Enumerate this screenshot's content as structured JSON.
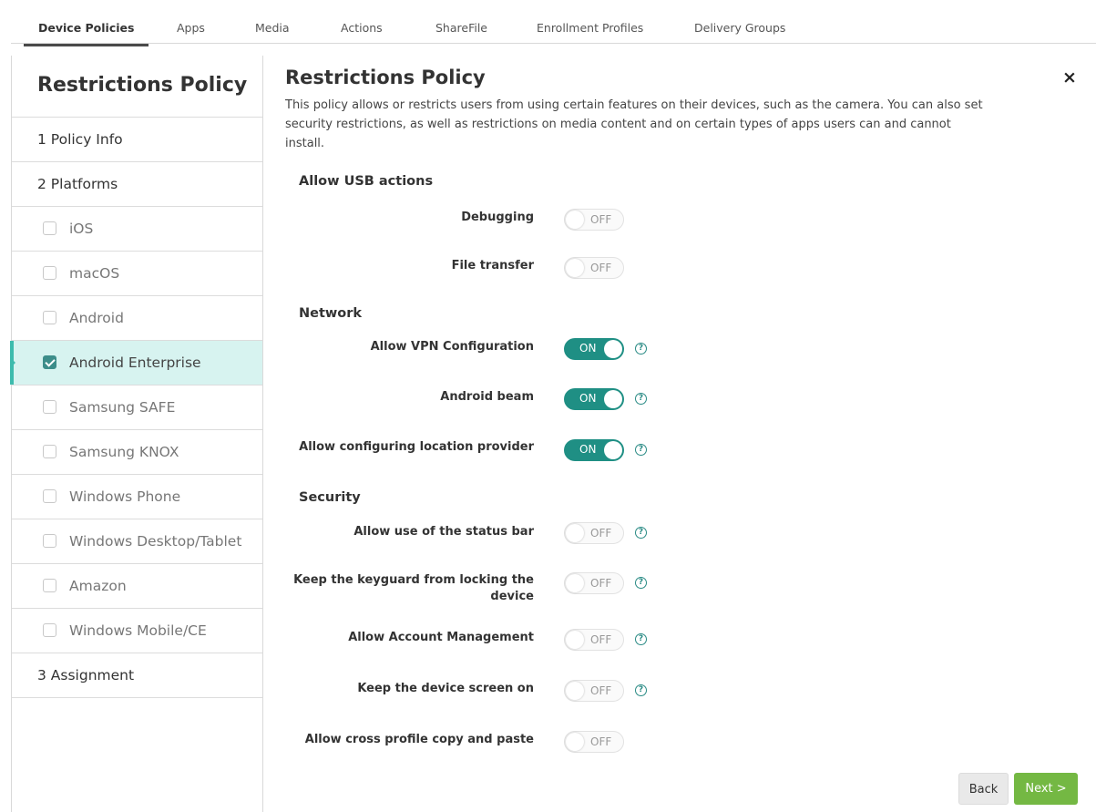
{
  "tabs": [
    {
      "label": "Device Policies",
      "active": true
    },
    {
      "label": "Apps"
    },
    {
      "label": "Media"
    },
    {
      "label": "Actions"
    },
    {
      "label": "ShareFile"
    },
    {
      "label": "Enrollment Profiles"
    },
    {
      "label": "Delivery Groups"
    }
  ],
  "sidebar": {
    "title": "Restrictions Policy",
    "steps": {
      "policy_info": "1 Policy Info",
      "platforms": "2 Platforms",
      "assignment": "3 Assignment"
    },
    "platforms": [
      {
        "label": "iOS",
        "checked": false
      },
      {
        "label": "macOS",
        "checked": false
      },
      {
        "label": "Android",
        "checked": false
      },
      {
        "label": "Android Enterprise",
        "checked": true
      },
      {
        "label": "Samsung SAFE",
        "checked": false
      },
      {
        "label": "Samsung KNOX",
        "checked": false
      },
      {
        "label": "Windows Phone",
        "checked": false
      },
      {
        "label": "Windows Desktop/Tablet",
        "checked": false
      },
      {
        "label": "Amazon",
        "checked": false
      },
      {
        "label": "Windows Mobile/CE",
        "checked": false
      }
    ]
  },
  "main": {
    "title": "Restrictions Policy",
    "description": "This policy allows or restricts users from using certain features on their devices, such as the camera. You can also set security restrictions, as well as restrictions on media content and on certain types of apps users can and cannot install.",
    "close_glyph": "×",
    "help_glyph": "?",
    "sections": {
      "usb": "Allow USB actions",
      "network": "Network",
      "security": "Security"
    },
    "settings": {
      "debugging": {
        "label": "Debugging",
        "state": "OFF"
      },
      "file_transfer": {
        "label": "File transfer",
        "state": "OFF"
      },
      "vpn": {
        "label": "Allow VPN Configuration",
        "state": "ON"
      },
      "beam": {
        "label": "Android beam",
        "state": "ON"
      },
      "location": {
        "label": "Allow configuring location provider",
        "state": "ON"
      },
      "status_bar": {
        "label": "Allow use of the status bar",
        "state": "OFF"
      },
      "keyguard_line1": "Keep the keyguard from locking the",
      "keyguard_line2": "device",
      "keyguard_state": "OFF",
      "account_mgmt": {
        "label": "Allow Account Management",
        "state": "OFF"
      },
      "screen_on": {
        "label": "Keep the device screen on",
        "state": "OFF"
      },
      "cross_profile": {
        "label": "Allow cross profile copy and paste",
        "state": "OFF"
      }
    },
    "buttons": {
      "back": "Back",
      "next": "Next >"
    }
  },
  "colors": {
    "toggle_on": "#1f8f84",
    "selected_row": "#d7f3f0",
    "selected_accent": "#3dbbad",
    "next_button": "#74b843",
    "help_icon": "#2a8b85"
  }
}
